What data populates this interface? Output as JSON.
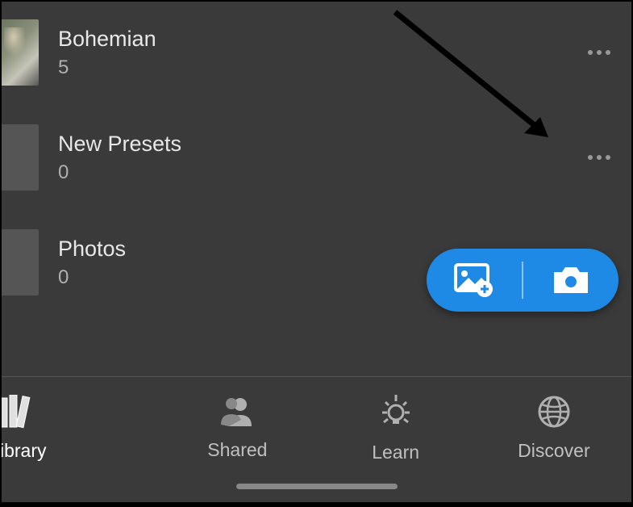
{
  "albums": [
    {
      "name": "Bohemian",
      "count": "5",
      "has_image": true
    },
    {
      "name": "New Presets",
      "count": "0",
      "has_image": false
    },
    {
      "name": "Photos",
      "count": "0",
      "has_image": false
    }
  ],
  "nav": {
    "library": "ibrary",
    "shared": "Shared",
    "learn": "Learn",
    "discover": "Discover"
  },
  "colors": {
    "accent": "#1e8ae6",
    "bg": "#3a3a3a"
  }
}
